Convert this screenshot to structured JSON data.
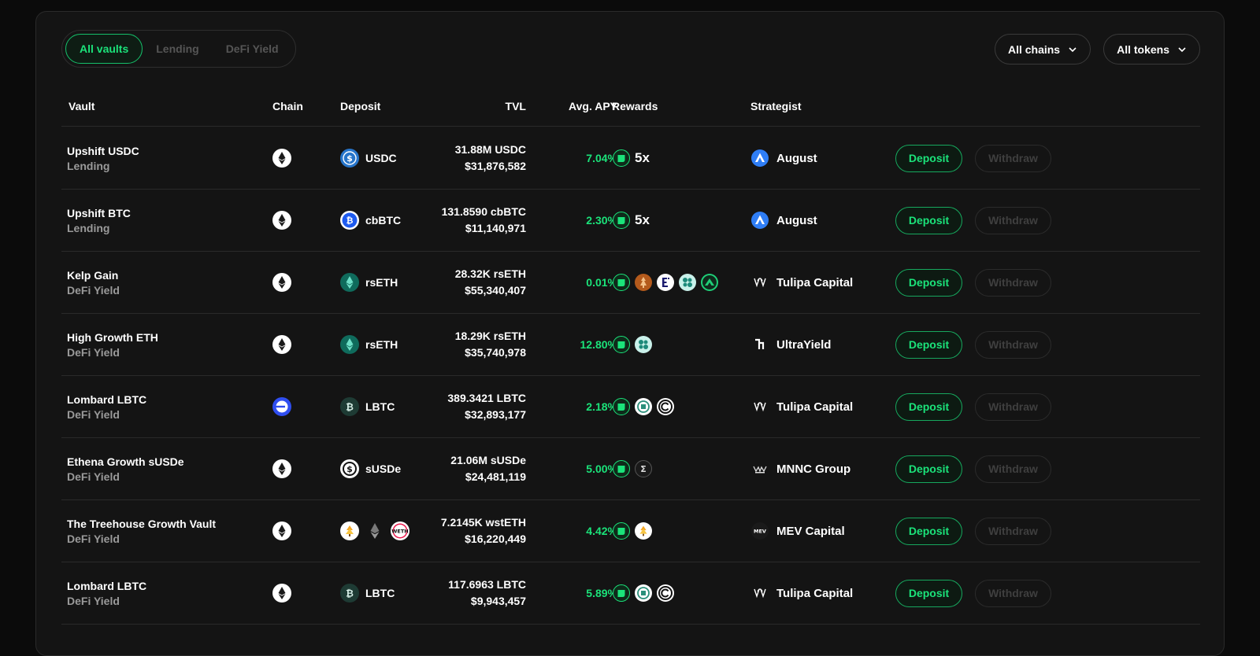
{
  "tabs": [
    "All vaults",
    "Lending",
    "DeFi Yield"
  ],
  "filters": {
    "chains": "All chains",
    "tokens": "All tokens"
  },
  "headers": {
    "vault": "Vault",
    "chain": "Chain",
    "deposit": "Deposit",
    "tvl": "TVL",
    "apy": "Avg. APY",
    "rewards": "Rewards",
    "strategist": "Strategist"
  },
  "actions": {
    "deposit": "Deposit",
    "withdraw": "Withdraw"
  },
  "colors": {
    "accent": "#1be37a",
    "background": "#141414"
  },
  "rows": [
    {
      "name": "Upshift USDC",
      "category": "Lending",
      "chain_icon": "ethereum-icon",
      "deposit_token": "USDC",
      "deposit_icons": [
        "usdc-icon"
      ],
      "tvl_amount": "31.88M USDC",
      "tvl_usd": "$31,876,582",
      "apy": "7.04%",
      "rewards": [
        "upshift-points-icon"
      ],
      "multiplier": "5x",
      "strategist": "August",
      "strategist_icon": "august-icon"
    },
    {
      "name": "Upshift BTC",
      "category": "Lending",
      "chain_icon": "ethereum-icon",
      "deposit_token": "cbBTC",
      "deposit_icons": [
        "cbbtc-icon"
      ],
      "tvl_amount": "131.8590 cbBTC",
      "tvl_usd": "$11,140,971",
      "apy": "2.30%",
      "rewards": [
        "upshift-points-icon"
      ],
      "multiplier": "5x",
      "strategist": "August",
      "strategist_icon": "august-icon"
    },
    {
      "name": "Kelp Gain",
      "category": "DeFi Yield",
      "chain_icon": "ethereum-icon",
      "deposit_token": "rsETH",
      "deposit_icons": [
        "rseth-icon"
      ],
      "tvl_amount": "28.32K rsETH",
      "tvl_usd": "$55,340,407",
      "apy": "0.01%",
      "rewards": [
        "upshift-points-icon",
        "kelp-icon",
        "eigen-icon",
        "symbiotic-icon",
        "karak-icon"
      ],
      "multiplier": "",
      "strategist": "Tulipa Capital",
      "strategist_icon": "tulipa-icon"
    },
    {
      "name": "High Growth ETH",
      "category": "DeFi Yield",
      "chain_icon": "ethereum-icon",
      "deposit_token": "rsETH",
      "deposit_icons": [
        "rseth-icon"
      ],
      "tvl_amount": "18.29K rsETH",
      "tvl_usd": "$35,740,978",
      "apy": "12.80%",
      "rewards": [
        "upshift-points-icon",
        "symbiotic-icon"
      ],
      "multiplier": "",
      "strategist": "UltraYield",
      "strategist_icon": "ultrayield-icon"
    },
    {
      "name": "Lombard LBTC",
      "category": "DeFi Yield",
      "chain_icon": "base-icon",
      "deposit_token": "LBTC",
      "deposit_icons": [
        "lbtc-icon"
      ],
      "tvl_amount": "389.3421 LBTC",
      "tvl_usd": "$32,893,177",
      "apy": "2.18%",
      "rewards": [
        "upshift-points-icon",
        "lombard-icon",
        "babylon-icon"
      ],
      "multiplier": "",
      "strategist": "Tulipa Capital",
      "strategist_icon": "tulipa-icon"
    },
    {
      "name": "Ethena Growth sUSDe",
      "category": "DeFi Yield",
      "chain_icon": "ethereum-icon",
      "deposit_token": "sUSDe",
      "deposit_icons": [
        "susde-icon"
      ],
      "tvl_amount": "21.06M sUSDe",
      "tvl_usd": "$24,481,119",
      "apy": "5.00%",
      "rewards": [
        "upshift-points-icon",
        "ethena-icon"
      ],
      "multiplier": "",
      "strategist": "MNNC Group",
      "strategist_icon": "mnnc-icon"
    },
    {
      "name": "The Treehouse Growth Vault",
      "category": "DeFi Yield",
      "chain_icon": "ethereum-icon",
      "deposit_token": "",
      "deposit_icons": [
        "treehouse-icon",
        "eth-icon",
        "weth-icon"
      ],
      "tvl_amount": "7.2145K wstETH",
      "tvl_usd": "$16,220,449",
      "apy": "4.42%",
      "rewards": [
        "upshift-points-icon",
        "treehouse-icon"
      ],
      "multiplier": "",
      "strategist": "MEV Capital",
      "strategist_icon": "mev-icon"
    },
    {
      "name": "Lombard LBTC",
      "category": "DeFi Yield",
      "chain_icon": "ethereum-icon",
      "deposit_token": "LBTC",
      "deposit_icons": [
        "lbtc-icon"
      ],
      "tvl_amount": "117.6963 LBTC",
      "tvl_usd": "$9,943,457",
      "apy": "5.89%",
      "rewards": [
        "upshift-points-icon",
        "lombard-icon",
        "babylon-icon"
      ],
      "multiplier": "",
      "strategist": "Tulipa Capital",
      "strategist_icon": "tulipa-icon"
    }
  ]
}
